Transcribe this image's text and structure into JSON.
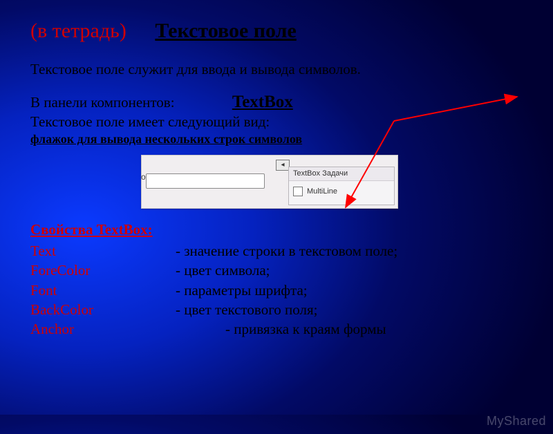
{
  "title": {
    "prefix": "(в тетрадь)",
    "main": "Текстовое поле"
  },
  "intro": "Текстовое поле служит для ввода  и вывода символов.",
  "components_line": "В панели компонентов:",
  "component_name": "TextBox",
  "appearance_line": "Текстовое поле имеет следующий вид:",
  "flag_line": "флажок для вывода нескольких строк символов",
  "screenshot": {
    "panel_header": "TextBox Задачи",
    "checkbox_label": "MultiLine"
  },
  "props_title": "Свойства    TextBox:",
  "props": [
    {
      "name": "Text",
      "desc": "- значение строки в текстовом поле;"
    },
    {
      "name": "ForeColor",
      "desc": "- цвет символа;"
    },
    {
      "name": "Font",
      "desc": "- параметры шрифта;"
    },
    {
      "name": "BackColor",
      "desc": "- цвет текстового поля;"
    },
    {
      "name": "Anchor",
      "desc": "- привязка к краям формы"
    }
  ],
  "watermark": "MyShared"
}
